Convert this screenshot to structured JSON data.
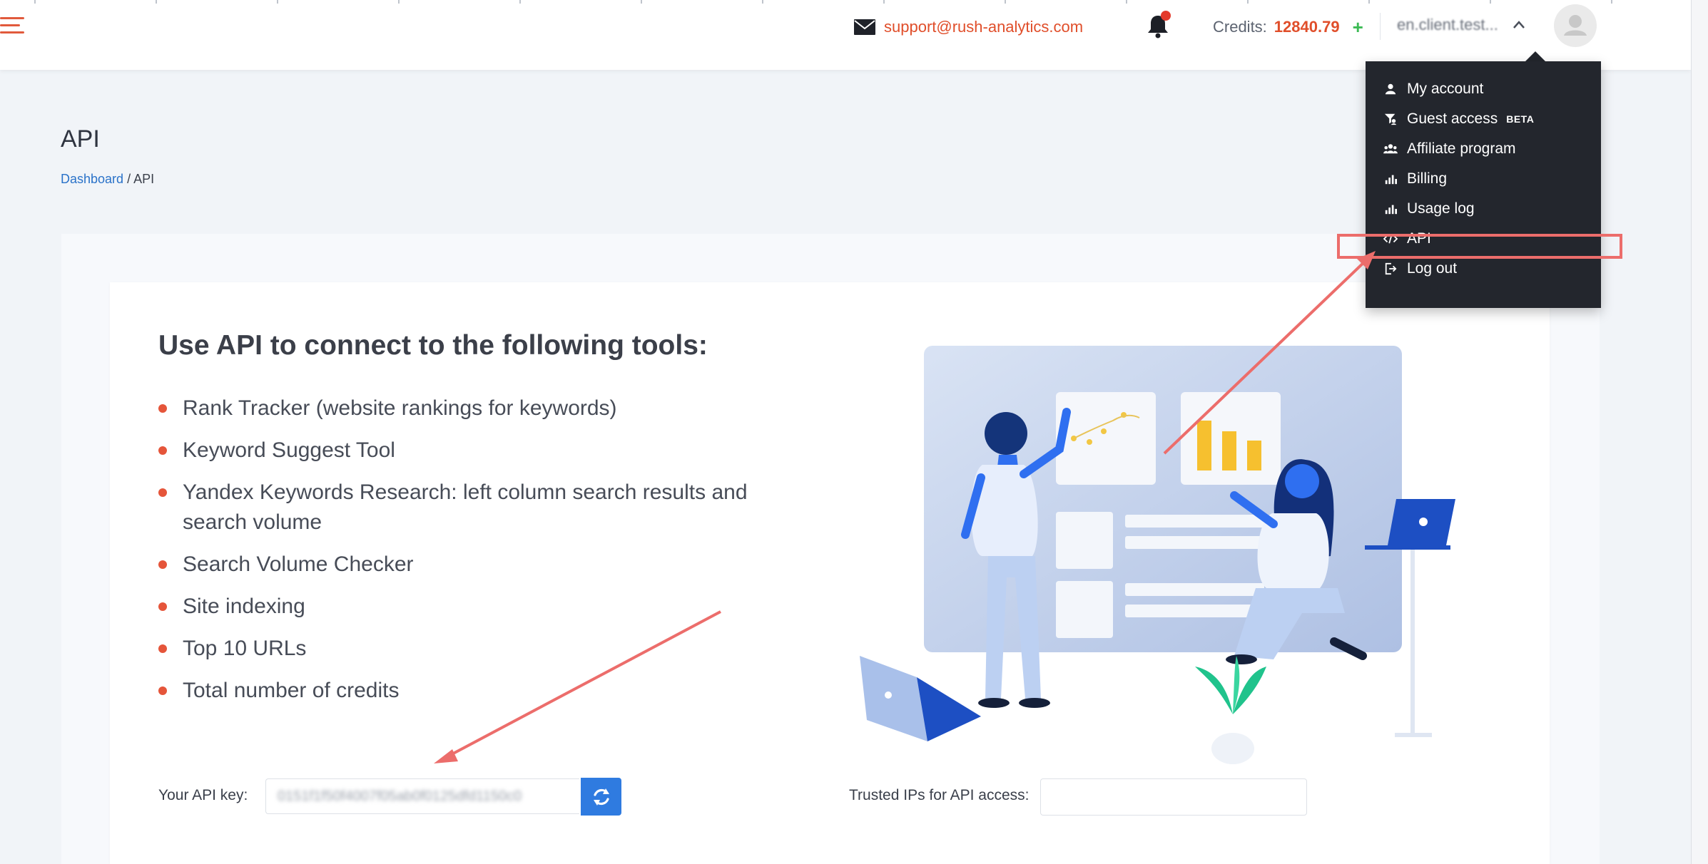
{
  "header": {
    "support_email": "support@rush-analytics.com",
    "credits_label": "Credits:",
    "credits_value": "12840.79",
    "add_credits_label": "+",
    "username": "en.client.test..."
  },
  "page": {
    "title": "API",
    "breadcrumb": {
      "home": "Dashboard",
      "separator": " / ",
      "current": "API"
    }
  },
  "tools_section": {
    "heading": "Use API to connect to the following tools:",
    "items": [
      "Rank Tracker (website rankings for keywords)",
      "Keyword Suggest Tool",
      "Yandex Keywords Research: left column search results and search volume",
      "Search Volume Checker",
      "Site indexing",
      "Top 10 URLs",
      "Total number of credits"
    ]
  },
  "api_key": {
    "label": "Your API key:",
    "value": "0151f1f50f4007f05ab0f0125dfd1150c0"
  },
  "trusted_ips": {
    "label": "Trusted IPs for API access:",
    "value": ""
  },
  "user_menu": {
    "items": [
      {
        "label": "My account",
        "icon": "user-icon"
      },
      {
        "label": "Guest access",
        "icon": "guest-access-icon",
        "badge": "BETA"
      },
      {
        "label": "Affiliate program",
        "icon": "affiliate-icon"
      },
      {
        "label": "Billing",
        "icon": "bar-chart-icon"
      },
      {
        "label": "Usage log",
        "icon": "bar-chart-icon"
      },
      {
        "label": "API",
        "icon": "code-icon"
      },
      {
        "label": "Log out",
        "icon": "logout-icon"
      }
    ]
  },
  "colors": {
    "accent": "#e04e2a",
    "link": "#2a72c9",
    "button": "#2f7be0",
    "menu_bg": "#23262d",
    "annotation": "#ec6d6b"
  }
}
